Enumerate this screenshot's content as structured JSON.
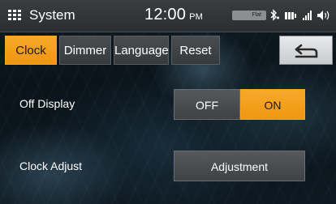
{
  "statusbar": {
    "title": "System",
    "time": "12:00",
    "ampm": "PM",
    "media_badge": "Flat",
    "icons": [
      "grid-menu-icon",
      "bluetooth-icon",
      "battery-icon",
      "signal-icon",
      "volume-icon"
    ]
  },
  "tabs": [
    {
      "label": "Clock",
      "active": true
    },
    {
      "label": "Dimmer",
      "active": false
    },
    {
      "label": "Language",
      "active": false
    },
    {
      "label": "Reset",
      "active": false
    }
  ],
  "back_icon": "back-arrow-icon",
  "settings": {
    "off_display": {
      "label": "Off Display",
      "options": [
        "OFF",
        "ON"
      ],
      "selected": "ON"
    },
    "clock_adjust": {
      "label": "Clock Adjust",
      "button_label": "Adjustment"
    }
  },
  "colors": {
    "accent": "#f5a524",
    "button_gray": "#4a4d50",
    "statusbar_bg": "#2f3235"
  }
}
